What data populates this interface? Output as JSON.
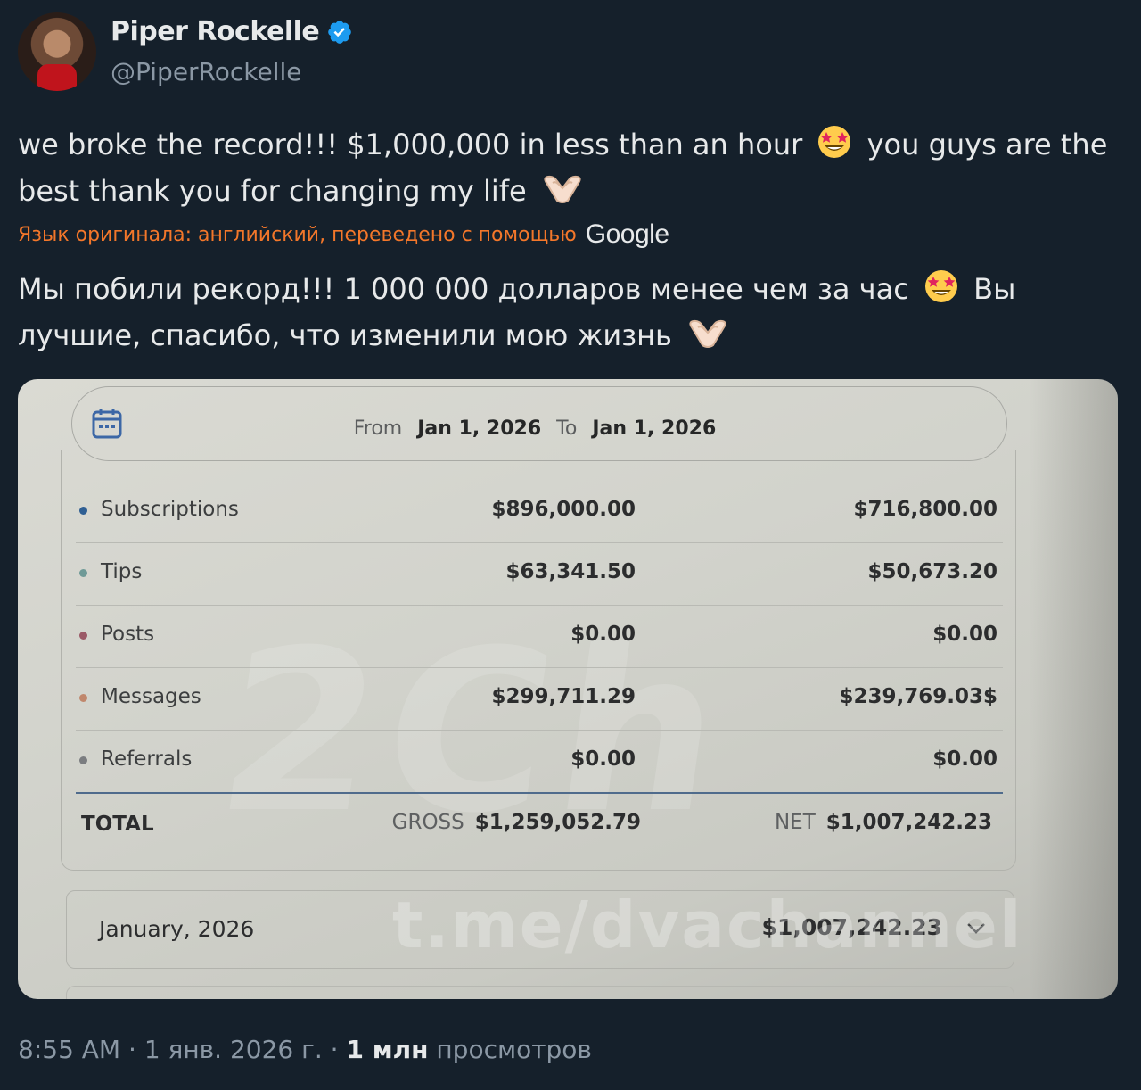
{
  "author": {
    "display_name": "Piper Rockelle",
    "handle": "@PiperRockelle",
    "verified": true,
    "verified_color": "#1d9bf0"
  },
  "tweet": {
    "text_part1": "we broke the record!!! $1,000,000 in less than an hour",
    "text_part2": "you guys are the best thank you for changing my life",
    "emoji_1": "star-struck",
    "emoji_2": "heart-hands",
    "translation_note": "Язык оригинала: английский, переведено с помощью",
    "translation_provider": "Google",
    "translated_part1": "Мы побили рекорд!!! 1 000 000 долларов менее чем за час",
    "translated_part2": "Вы лучшие, спасибо, что изменили мою жизнь"
  },
  "photo": {
    "date_range": {
      "from_label": "From",
      "from": "Jan 1, 2026",
      "to_label": "To",
      "to": "Jan 1, 2026"
    },
    "rows": [
      {
        "label": "Subscriptions",
        "gross": "$896,000.00",
        "net": "$716,800.00",
        "dot_color": "#2f5f93"
      },
      {
        "label": "Tips",
        "gross": "$63,341.50",
        "net": "$50,673.20",
        "dot_color": "#6f9a97"
      },
      {
        "label": "Posts",
        "gross": "$0.00",
        "net": "$0.00",
        "dot_color": "#9b5a67"
      },
      {
        "label": "Messages",
        "gross": "$299,711.29",
        "net": "$239,769.03$",
        "dot_color": "#c0876c"
      },
      {
        "label": "Referrals",
        "gross": "$0.00",
        "net": "$0.00",
        "dot_color": "#7b7d80"
      }
    ],
    "total": {
      "label": "TOTAL",
      "gross_tag": "GROSS",
      "gross": "$1,259,052.79",
      "net_tag": "NET",
      "net": "$1,007,242.23"
    },
    "month": {
      "label": "January, 2026",
      "amount": "$1,007,242.23"
    },
    "watermark": "t.me/dvachannel",
    "watermark_logo": "2Ch"
  },
  "meta": {
    "time": "8:55 AM",
    "date": "1 янв. 2026 г.",
    "views_count": "1 млн",
    "views_label": "просмотров"
  }
}
